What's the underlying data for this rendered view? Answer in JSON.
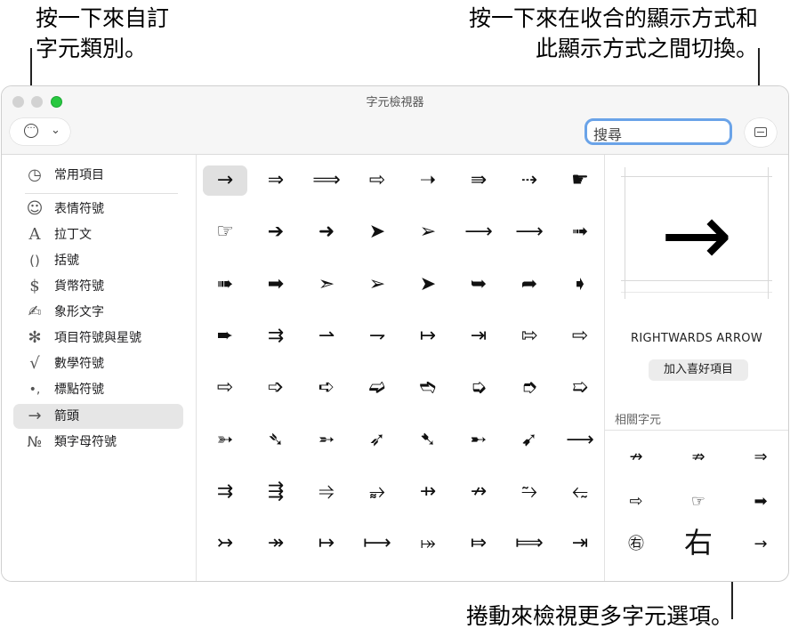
{
  "callouts": {
    "left": [
      "按一下來自訂",
      "字元類別。"
    ],
    "right": [
      "按一下來在收合的顯示方式和",
      "此顯示方式之間切換。"
    ],
    "bottom": "捲動來檢視更多字元選項。"
  },
  "window": {
    "title": "字元檢視器"
  },
  "toolbar": {
    "search_placeholder": "搜尋",
    "actions_icon": "ellipsis-circle-icon",
    "toggle_icon": "view-toggle-icon"
  },
  "sidebar": {
    "items": [
      {
        "icon": "◷",
        "label": "常用項目"
      },
      {
        "icon": "☺",
        "label": "表情符號"
      },
      {
        "icon": "A",
        "label": "拉丁文"
      },
      {
        "icon": "()",
        "label": "括號"
      },
      {
        "icon": "$",
        "label": "貨幣符號"
      },
      {
        "icon": "✍",
        "label": "象形文字"
      },
      {
        "icon": "✻",
        "label": "項目符號與星號"
      },
      {
        "icon": "√",
        "label": "數學符號"
      },
      {
        "icon": "•,",
        "label": "標點符號"
      },
      {
        "icon": "→",
        "label": "箭頭"
      },
      {
        "icon": "№",
        "label": "類字母符號"
      }
    ],
    "selected": "箭頭"
  },
  "grid": {
    "rows": [
      [
        "→",
        "⇒",
        "⟹",
        "⇨",
        "➝",
        "⇛",
        "⇢",
        "☛"
      ],
      [
        "☞",
        "➔",
        "➜",
        "➤",
        "➢",
        "⟶",
        "⟶",
        "➟"
      ],
      [
        "➠",
        "➡",
        "➣",
        "➢",
        "➤",
        "➥",
        "➦",
        "➧"
      ],
      [
        "➨",
        "⇉",
        "⇀",
        "⇁",
        "↦",
        "⇥",
        "⇰",
        "⇨"
      ],
      [
        "⇨",
        "➩",
        "➪",
        "➫",
        "➬",
        "➭",
        "➮",
        "➯"
      ],
      [
        "➳",
        "➴",
        "➵",
        "➶",
        "➷",
        "➸",
        "➹",
        "⟶"
      ],
      [
        "⇉",
        "⇶",
        "⥤",
        "⥵",
        "⇸",
        "↛",
        "⥲",
        "⥳"
      ],
      [
        "↣",
        "↠",
        "↦",
        "⟼",
        "⤅",
        "⤇",
        "⟾",
        "⇥"
      ],
      [
        "⇁",
        "⇀",
        "⇝",
        "⟿",
        "⤳",
        "⥈",
        "⇸",
        "⇻"
      ],
      [
        "⤁",
        "⤔",
        "⇢",
        "⤏",
        "⤑",
        "⤐",
        "⤖",
        "⤘"
      ]
    ],
    "selected_index": 0
  },
  "detail": {
    "glyph": "→",
    "name": "RIGHTWARDS ARROW",
    "favorite_label": "加入喜好項目",
    "related_title": "相關字元",
    "related": [
      "↛",
      "⇏",
      "⇒",
      "⇨",
      "☞",
      "➡",
      "㊨",
      "右",
      "→"
    ]
  }
}
